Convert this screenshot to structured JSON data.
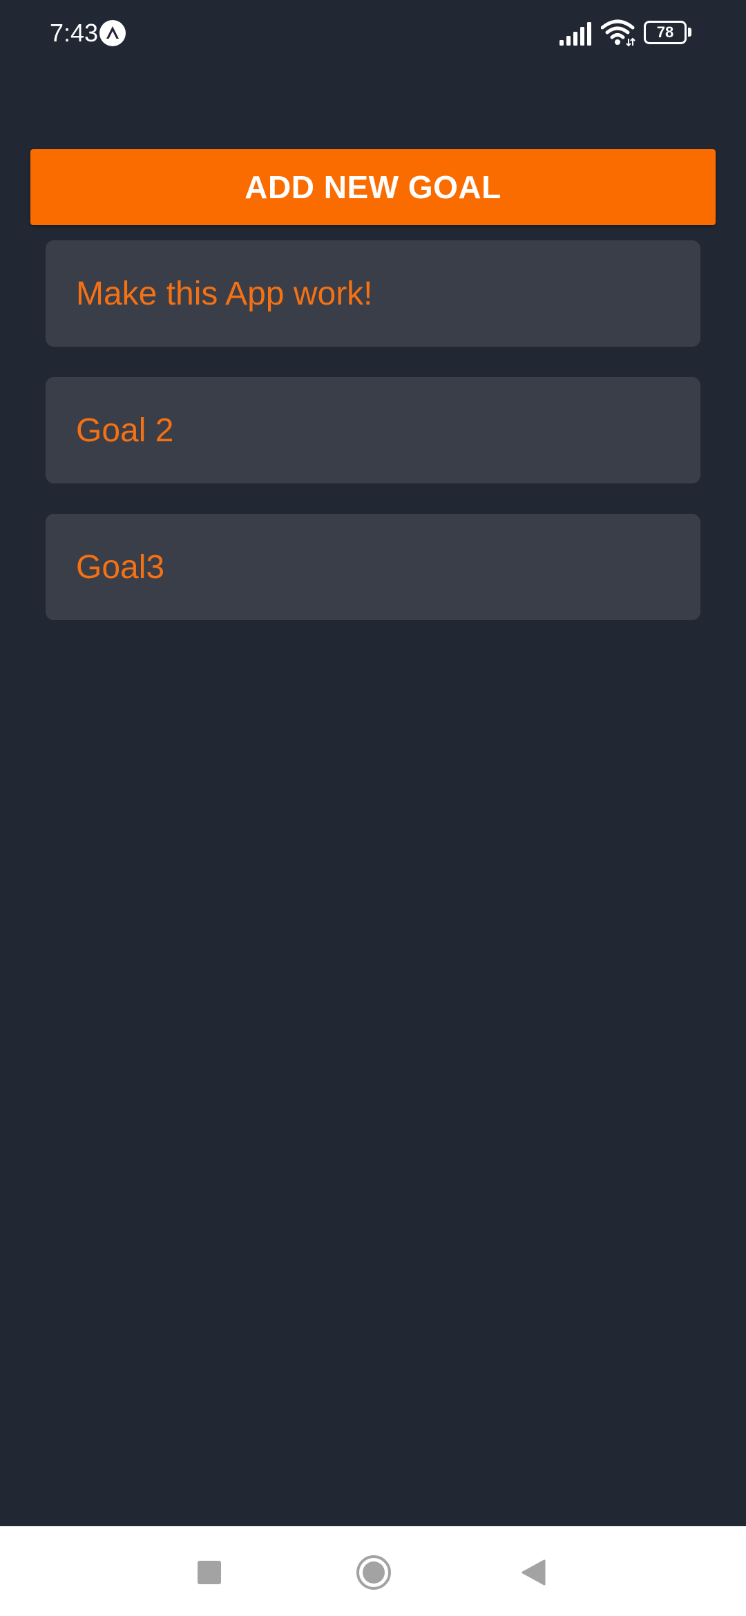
{
  "status_bar": {
    "time": "7:43",
    "battery_level": "78",
    "icons": [
      "expo-icon",
      "signal-icon",
      "wifi-icon",
      "battery-icon"
    ]
  },
  "add_button": {
    "label": "ADD NEW GOAL"
  },
  "goals": [
    {
      "text": "Make this App work!"
    },
    {
      "text": "Goal 2"
    },
    {
      "text": "Goal3"
    }
  ],
  "nav_bar": {
    "icons": [
      "recents-icon",
      "home-icon",
      "back-icon"
    ]
  },
  "colors": {
    "background": "#222833",
    "accent": "#fb6c00",
    "goal_background": "#3a3e48",
    "goal_text": "#f57113",
    "nav_background": "#ffffff"
  }
}
